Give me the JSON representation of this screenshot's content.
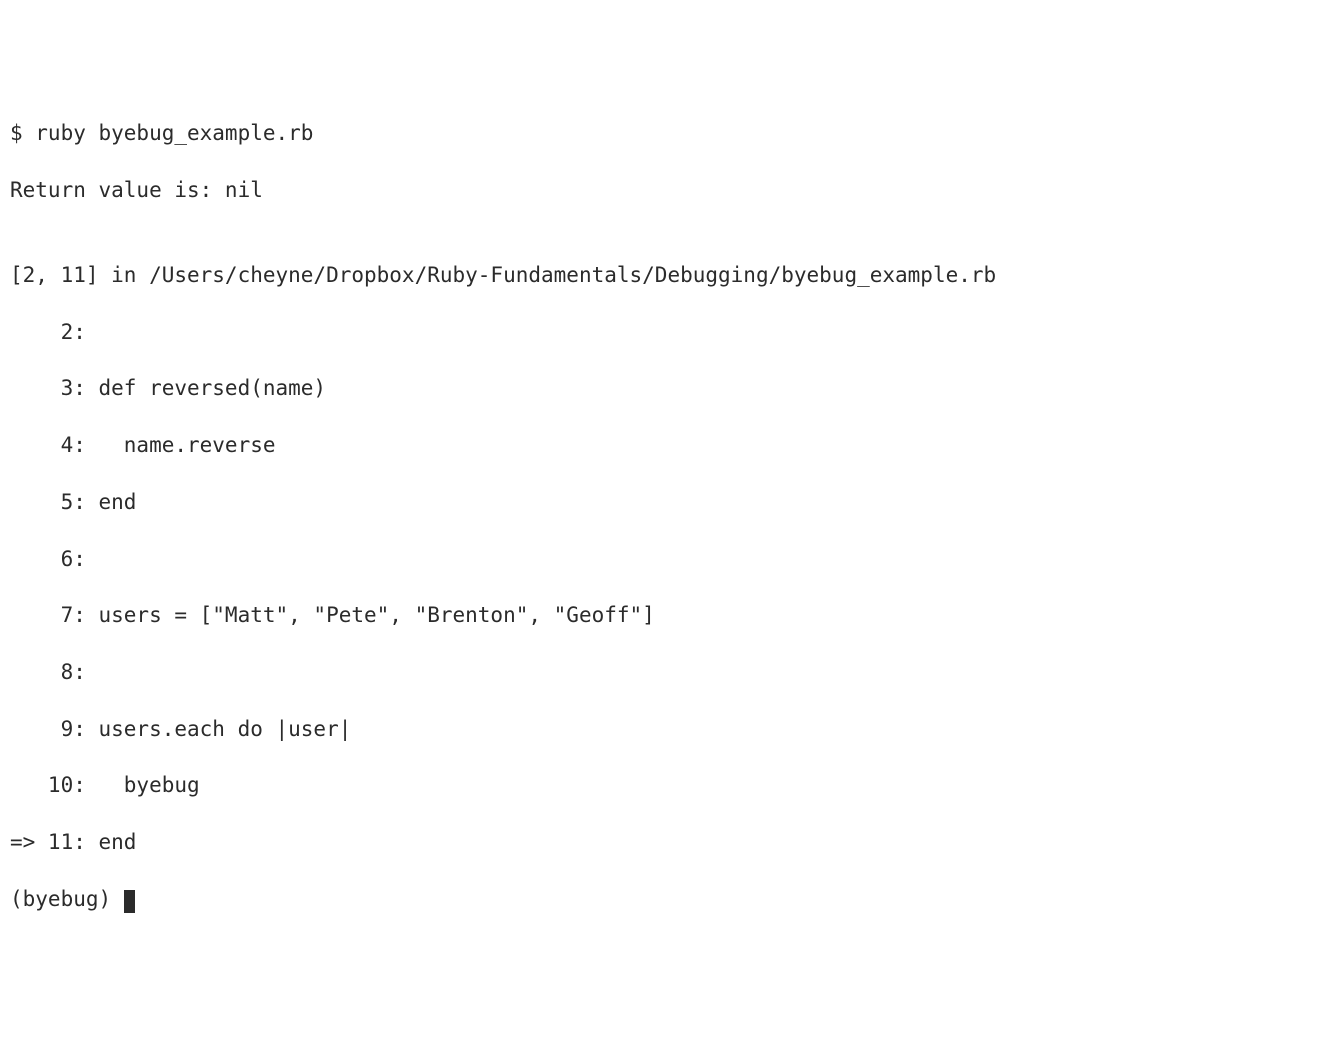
{
  "terminal": {
    "commandLine": "$ ruby byebug_example.rb",
    "returnLine": "Return value is: nil",
    "blank0": "",
    "fileRange": "[2, 11] in /Users/cheyne/Dropbox/Ruby-Fundamentals/Debugging/byebug_example.rb",
    "code": {
      "l2": "    2:",
      "l3": "    3: def reversed(name)",
      "l4": "    4:   name.reverse",
      "l5": "    5: end",
      "l6": "    6:",
      "l7": "    7: users = [\"Matt\", \"Pete\", \"Brenton\", \"Geoff\"]",
      "l8": "    8:",
      "l9": "    9: users.each do |user|",
      "l10": "   10:   byebug",
      "l11": "=> 11: end"
    },
    "prompt": "(byebug) "
  }
}
